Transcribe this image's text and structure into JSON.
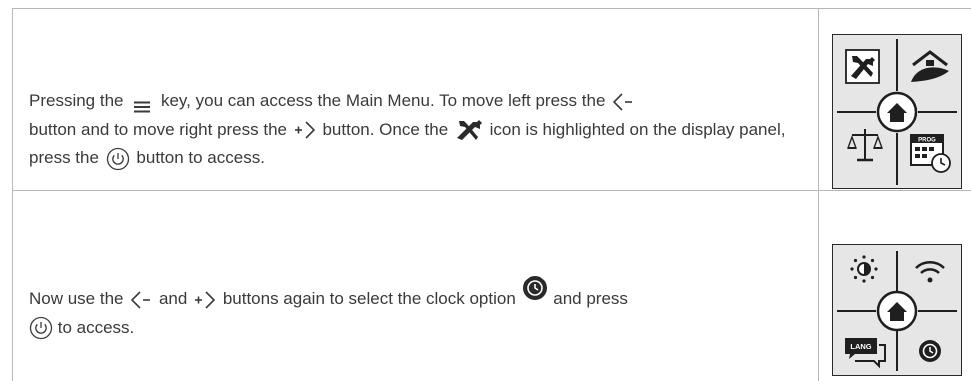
{
  "rows": [
    {
      "segments": [
        "Pressing the",
        "key, you can access the Main Menu. To move left press the",
        "button and to move right press the",
        "button. Once the",
        "icon is highlighted on the display panel, press the",
        "button to access."
      ],
      "panel": {
        "icons": [
          "tools-icon",
          "home-leaf-icon",
          "home-icon",
          "scale-icon",
          "calendar-clock-icon"
        ],
        "badge": "PROG"
      }
    },
    {
      "segments": [
        "Now use the",
        "and",
        "buttons again to select the clock option",
        "and press",
        "to access."
      ],
      "panel": {
        "icons": [
          "brightness-icon",
          "wifi-icon",
          "home-icon",
          "language-icon",
          "clock-icon"
        ],
        "badge": "LANG"
      }
    }
  ],
  "colors": {
    "text": "#3a3a3a",
    "border": "#b7b7b7",
    "panel_bg": "#e6e6e6"
  }
}
